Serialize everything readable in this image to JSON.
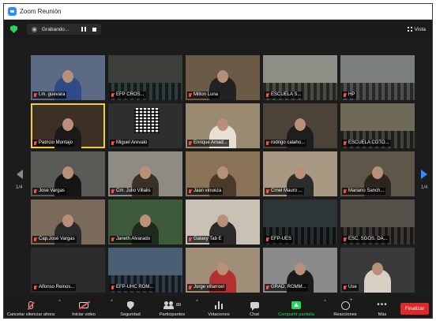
{
  "window": {
    "title": "Zoom Reunión"
  },
  "topbar": {
    "recording_label": "Grabando...",
    "view_label": "Vista",
    "accent_color": "#23d959"
  },
  "gallery": {
    "page_left": "1/4",
    "page_right": "1/4",
    "active_speaker_color": "#f2d02c",
    "tiles": [
      {
        "name": "t.m. guevara",
        "bg": "#5c6a86",
        "kind": "person",
        "tone": "#2e4b88"
      },
      {
        "name": "EFP CROS...",
        "bg": "#3c3f3a",
        "kind": "crowd",
        "tone": "#1f2a2a"
      },
      {
        "name": "Milton Luna",
        "bg": "#6b5a46",
        "kind": "person",
        "tone": "#222222"
      },
      {
        "name": "ESCUELA S...",
        "bg": "#8e8f86",
        "kind": "crowd",
        "tone": "#3b3b34"
      },
      {
        "name": "HP",
        "bg": "#7b7f80",
        "kind": "crowd",
        "tone": "#3d4040"
      },
      {
        "name": "Patricio Montajo",
        "bg": "#3e2f26",
        "kind": "person",
        "tone": "#1a1a1a",
        "active": true
      },
      {
        "name": "Miguel Arevalo",
        "bg": "#2e2e2e",
        "kind": "qr",
        "tone": "#2e2e2e"
      },
      {
        "name": "Enrique Amad...",
        "bg": "#9a8a6f",
        "kind": "person",
        "tone": "#e6dfd2"
      },
      {
        "name": "rodrigo calaho...",
        "bg": "#4d4238",
        "kind": "person",
        "tone": "#1e1e1e"
      },
      {
        "name": "ESCUELA COTO...",
        "bg": "#6f6a58",
        "kind": "crowd",
        "tone": "#2f3028"
      },
      {
        "name": "Jose Vargas",
        "bg": "#5a5a56",
        "kind": "person",
        "tone": "#151515"
      },
      {
        "name": "Cm. Julio Villalis",
        "bg": "#8e8b84",
        "kind": "person",
        "tone": "#3a3024"
      },
      {
        "name": "Jaan vinueza",
        "bg": "#8a7356",
        "kind": "person",
        "tone": "#4b3a2a"
      },
      {
        "name": "Crnel Mauro ...",
        "bg": "#a89a82",
        "kind": "person",
        "tone": "#2c2c2c"
      },
      {
        "name": "Mariano Sanch...",
        "bg": "#5e5749",
        "kind": "person",
        "tone": "#2a2520"
      },
      {
        "name": "Cap.José Vargas",
        "bg": "#7a6a5a",
        "kind": "person",
        "tone": "#2a2a2a"
      },
      {
        "name": "Janeth Alvarado",
        "bg": "#3d5a3a",
        "kind": "person",
        "tone": "#1f2a1f"
      },
      {
        "name": "Galaxy Tab E",
        "bg": "#c9c2b4",
        "kind": "person",
        "tone": "#2a2a2a"
      },
      {
        "name": "EFP-UES",
        "bg": "#2e3538",
        "kind": "crowd",
        "tone": "#151a1c"
      },
      {
        "name": "ESC. SGOS. DA...",
        "bg": "#55504a",
        "kind": "crowd",
        "tone": "#2a2622"
      },
      {
        "name": "Alfonso Reinos...",
        "bg": "#2b2b2b",
        "kind": "empty",
        "tone": "#2b2b2b"
      },
      {
        "name": "EFP-UHC ROM...",
        "bg": "#4a5f74",
        "kind": "crowd",
        "tone": "#1f2a36"
      },
      {
        "name": "Jorge villarroel",
        "bg": "#a08e78",
        "kind": "person",
        "tone": "#b3312c"
      },
      {
        "name": "GRAD. ROMM...",
        "bg": "#8a8a8a",
        "kind": "person",
        "tone": "#1a1a1a"
      },
      {
        "name": "Use",
        "bg": "#3a3a3a",
        "kind": "person",
        "tone": "#d8d0c4"
      }
    ]
  },
  "toolbar": {
    "mute_label": "Cancelar silenciar ahora",
    "video_label": "Iniciar video",
    "security_label": "Seguridad",
    "participants_label": "Participantes",
    "participants_count": "89",
    "polls_label": "Votaciones",
    "chat_label": "Chat",
    "share_label": "Compartir pantalla",
    "reactions_label": "Reacciones",
    "more_label": "Más",
    "end_label": "Finalizar",
    "end_color": "#e02828"
  }
}
